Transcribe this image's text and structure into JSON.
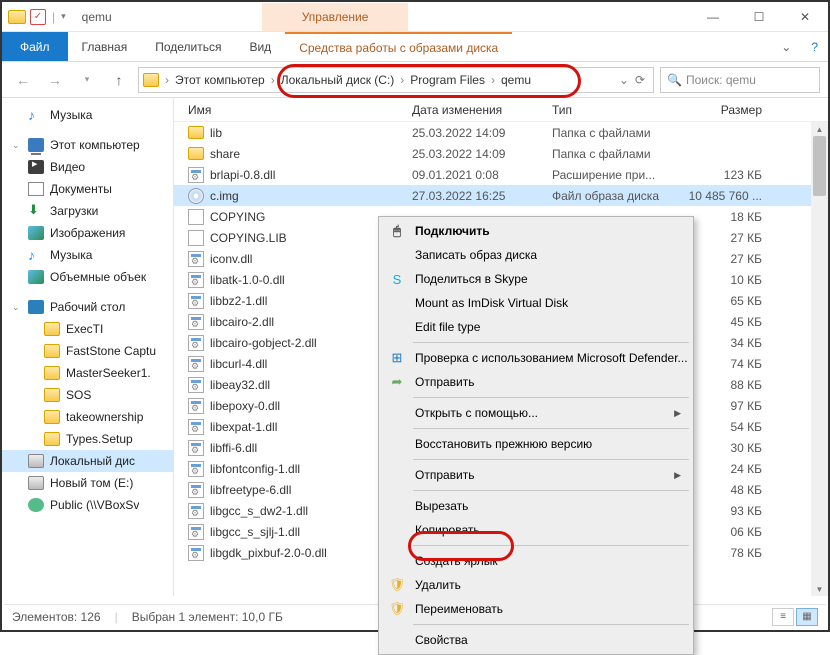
{
  "title": "qemu",
  "manage_tab": "Управление",
  "ribbon": {
    "file": "Файл",
    "home": "Главная",
    "share": "Поделиться",
    "view": "Вид",
    "disc_tools": "Средства работы с образами диска"
  },
  "breadcrumb": [
    "Этот компьютер",
    "Локальный диск (C:)",
    "Program Files",
    "qemu"
  ],
  "search": {
    "placeholder": "Поиск: qemu"
  },
  "columns": {
    "name": "Имя",
    "date": "Дата изменения",
    "type": "Тип",
    "size": "Размер"
  },
  "sidebar": [
    {
      "icon": "music",
      "label": "Музыка"
    },
    {
      "icon": "pc",
      "label": "Этот компьютер",
      "exp": true
    },
    {
      "icon": "video",
      "label": "Видео"
    },
    {
      "icon": "doc",
      "label": "Документы"
    },
    {
      "icon": "dl",
      "label": "Загрузки"
    },
    {
      "icon": "img",
      "label": "Изображения"
    },
    {
      "icon": "music",
      "label": "Музыка"
    },
    {
      "icon": "img",
      "label": "Объемные объек"
    },
    {
      "icon": "desk",
      "label": "Рабочий стол",
      "exp": true
    },
    {
      "icon": "folder",
      "label": "ExecTI",
      "indent": 1
    },
    {
      "icon": "folder",
      "label": "FastStone Captu",
      "indent": 1
    },
    {
      "icon": "folder",
      "label": "MasterSeeker1.",
      "indent": 1
    },
    {
      "icon": "folder",
      "label": "SOS",
      "indent": 1
    },
    {
      "icon": "folder",
      "label": "takeownership",
      "indent": 1
    },
    {
      "icon": "folder",
      "label": "Types.Setup",
      "indent": 1
    },
    {
      "icon": "drive",
      "label": "Локальный дис",
      "selected": true
    },
    {
      "icon": "drive",
      "label": "Новый том (E:)"
    },
    {
      "icon": "net",
      "label": "Public (\\\\VBoxSv"
    }
  ],
  "files": [
    {
      "icon": "folder",
      "name": "lib",
      "date": "25.03.2022 14:09",
      "type": "Папка с файлами",
      "size": ""
    },
    {
      "icon": "folder",
      "name": "share",
      "date": "25.03.2022 14:09",
      "type": "Папка с файлами",
      "size": ""
    },
    {
      "icon": "dll",
      "name": "brlapi-0.8.dll",
      "date": "09.01.2021 0:08",
      "type": "Расширение при...",
      "size": "123 КБ"
    },
    {
      "icon": "disc",
      "name": "c.img",
      "date": "27.03.2022 16:25",
      "type": "Файл образа диска",
      "size": "10 485 760 ...",
      "selected": true
    },
    {
      "icon": "txt",
      "name": "COPYING",
      "date": "",
      "type": "",
      "size": "18 КБ"
    },
    {
      "icon": "txt",
      "name": "COPYING.LIB",
      "date": "",
      "type": "",
      "size": "27 КБ"
    },
    {
      "icon": "dll",
      "name": "iconv.dll",
      "date": "",
      "type": "",
      "size": "27 КБ"
    },
    {
      "icon": "dll",
      "name": "libatk-1.0-0.dll",
      "date": "",
      "type": "",
      "size": "10 КБ"
    },
    {
      "icon": "dll",
      "name": "libbz2-1.dll",
      "date": "",
      "type": "",
      "size": "65 КБ"
    },
    {
      "icon": "dll",
      "name": "libcairo-2.dll",
      "date": "",
      "type": "",
      "size": "45 КБ"
    },
    {
      "icon": "dll",
      "name": "libcairo-gobject-2.dll",
      "date": "",
      "type": "",
      "size": "34 КБ"
    },
    {
      "icon": "dll",
      "name": "libcurl-4.dll",
      "date": "",
      "type": "",
      "size": "74 КБ"
    },
    {
      "icon": "dll",
      "name": "libeay32.dll",
      "date": "",
      "type": "",
      "size": "88 КБ"
    },
    {
      "icon": "dll",
      "name": "libepoxy-0.dll",
      "date": "",
      "type": "",
      "size": "97 КБ"
    },
    {
      "icon": "dll",
      "name": "libexpat-1.dll",
      "date": "",
      "type": "",
      "size": "54 КБ"
    },
    {
      "icon": "dll",
      "name": "libffi-6.dll",
      "date": "",
      "type": "",
      "size": "30 КБ"
    },
    {
      "icon": "dll",
      "name": "libfontconfig-1.dll",
      "date": "",
      "type": "",
      "size": "24 КБ"
    },
    {
      "icon": "dll",
      "name": "libfreetype-6.dll",
      "date": "",
      "type": "",
      "size": "48 КБ"
    },
    {
      "icon": "dll",
      "name": "libgcc_s_dw2-1.dll",
      "date": "",
      "type": "",
      "size": "93 КБ"
    },
    {
      "icon": "dll",
      "name": "libgcc_s_sjlj-1.dll",
      "date": "",
      "type": "",
      "size": "06 КБ"
    },
    {
      "icon": "dll",
      "name": "libgdk_pixbuf-2.0-0.dll",
      "date": "",
      "type": "",
      "size": "78 КБ"
    }
  ],
  "contextmenu": [
    {
      "label": "Подключить",
      "bold": true,
      "icon": "🖱"
    },
    {
      "label": "Записать образ диска"
    },
    {
      "label": "Поделиться в Skype",
      "icon": "S",
      "iconColor": "#00aff0"
    },
    {
      "label": "Mount as ImDisk Virtual Disk"
    },
    {
      "label": "Edit file type"
    },
    {
      "sep": true
    },
    {
      "label": "Проверка с использованием Microsoft Defender...",
      "icon": "⊞",
      "iconColor": "#1979ca"
    },
    {
      "label": "Отправить",
      "icon": "➦",
      "iconColor": "#6a6"
    },
    {
      "sep": true
    },
    {
      "label": "Открыть с помощью...",
      "sub": true
    },
    {
      "sep": true
    },
    {
      "label": "Восстановить прежнюю версию"
    },
    {
      "sep": true
    },
    {
      "label": "Отправить",
      "sub": true
    },
    {
      "sep": true
    },
    {
      "label": "Вырезать"
    },
    {
      "label": "Копировать"
    },
    {
      "sep": true
    },
    {
      "label": "Создать ярлык"
    },
    {
      "label": "Удалить",
      "icon": "🛡",
      "iconColor": "#e8b02a"
    },
    {
      "label": "Переименовать",
      "icon": "🛡",
      "iconColor": "#e8b02a"
    },
    {
      "sep": true
    },
    {
      "label": "Свойства"
    }
  ],
  "status": {
    "count": "Элементов: 126",
    "sel": "Выбран 1 элемент: 10,0 ГБ"
  }
}
